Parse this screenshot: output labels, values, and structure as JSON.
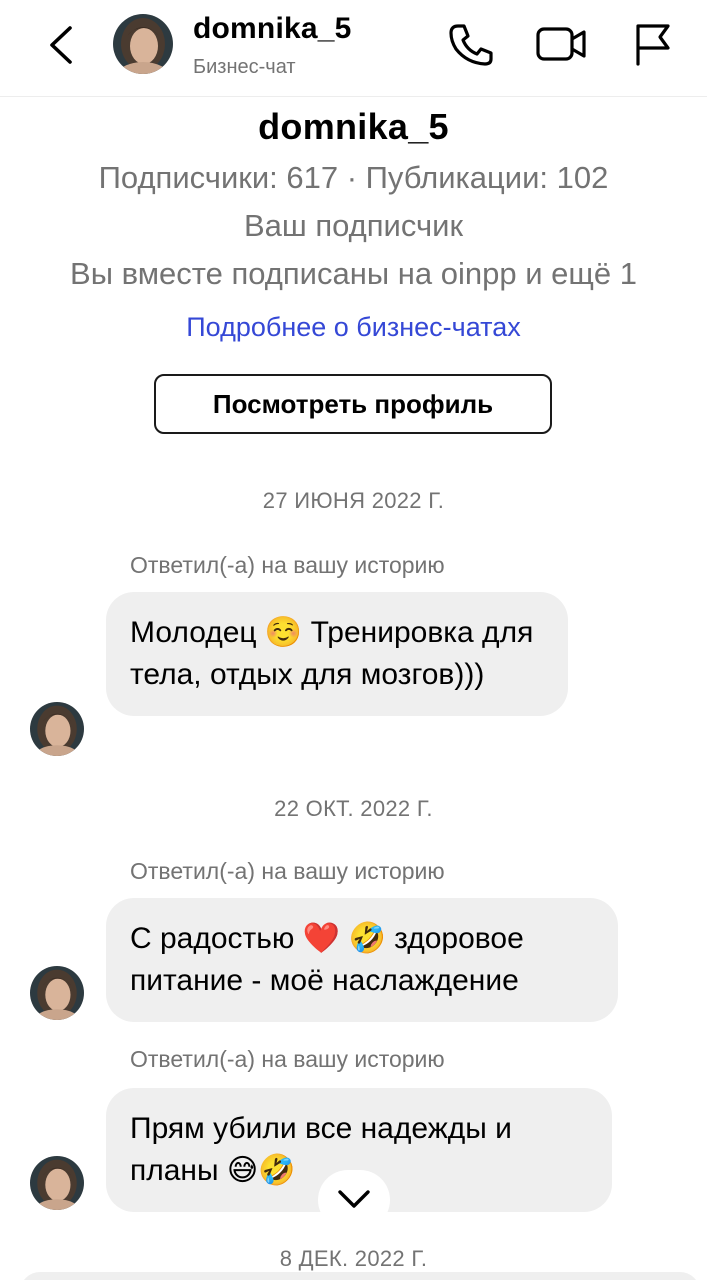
{
  "header": {
    "username": "domnika_5",
    "subtitle": "Бизнес-чат",
    "icons": [
      "chevron-left-icon",
      "phone-icon",
      "video-camera-icon",
      "flag-icon"
    ]
  },
  "profile": {
    "name": "domnika_5",
    "stats": "Подписчики: 617 · Публикации: 102",
    "follow_status": "Ваш подписчик",
    "mutual": "Вы вместе подписаны на oinpp и ещё 1",
    "business_link": "Подробнее о бизнес-чатах",
    "view_profile_label": "Посмотреть профиль"
  },
  "conversation": [
    {
      "date": "27 ИЮНЯ 2022 Г.",
      "reply_label": "Ответил(-а) на вашу историю",
      "message": "Молодец ☺️ Тренировка для тела, отдых для мозгов)))"
    },
    {
      "date": "22 ОКТ. 2022 Г.",
      "reply_label": "Ответил(-а) на вашу историю",
      "message": "С радостью ❤️ 🤣 здоровое питание - моё наслаждение"
    },
    {
      "reply_label": "Ответил(-а) на вашу историю",
      "message": "Прям убили все надежды и планы 😅🤣"
    },
    {
      "date": "8 ДЕК. 2022 Г."
    }
  ],
  "colors": {
    "link": "#3548d6",
    "muted_text": "#737373",
    "bubble_bg": "#efefef"
  }
}
